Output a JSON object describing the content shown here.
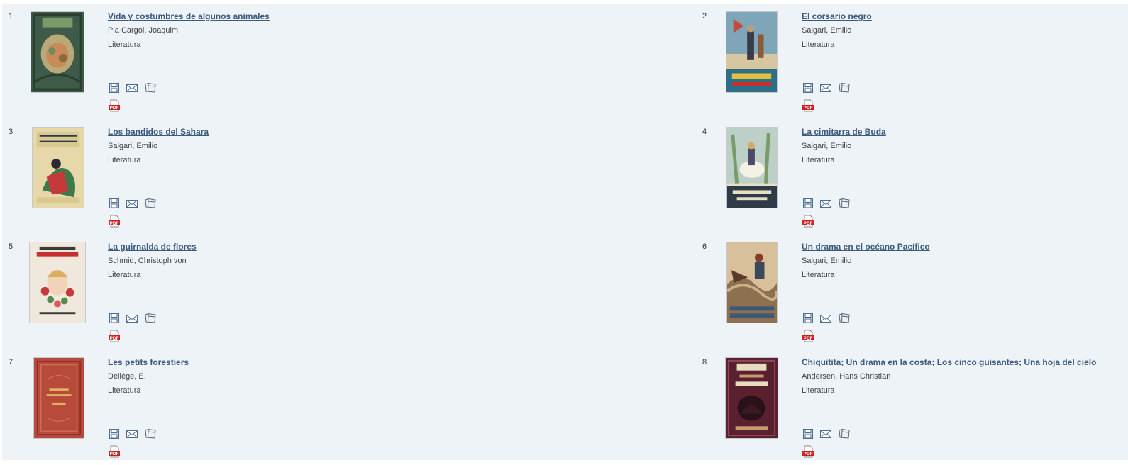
{
  "colors": {
    "panel": "#eef3f8",
    "link": "#3c5a7e",
    "text": "#444444",
    "pdf_red": "#cc1f1f"
  },
  "icons": {
    "save": "save-icon",
    "email": "email-icon",
    "bookshelf": "bookshelf-icon",
    "pdf": "pdf-icon"
  },
  "results": [
    {
      "number": "1",
      "title": "Vida y costumbres de algunos animales",
      "author": "Pla Cargol, Joaquim",
      "genre": "Literatura",
      "pdf_label": "PDF"
    },
    {
      "number": "2",
      "title": "El corsario negro",
      "author": "Salgari, Emilio",
      "genre": "Literatura",
      "pdf_label": "PDF"
    },
    {
      "number": "3",
      "title": "Los bandidos del Sahara",
      "author": "Salgari, Emilio",
      "genre": "Literatura",
      "pdf_label": "PDF"
    },
    {
      "number": "4",
      "title": "La cimitarra de Buda",
      "author": "Salgari, Emilio",
      "genre": "Literatura",
      "pdf_label": "PDF"
    },
    {
      "number": "5",
      "title": "La guirnalda de flores",
      "author": "Schmid, Christoph von",
      "genre": "Literatura",
      "pdf_label": "PDF"
    },
    {
      "number": "6",
      "title": "Un drama en el océano Pacífico",
      "author": "Salgari, Emilio",
      "genre": "Literatura",
      "pdf_label": "PDF"
    },
    {
      "number": "7",
      "title": "Les petits forestiers",
      "author": "Deliège, E.",
      "genre": "Literatura",
      "pdf_label": "PDF"
    },
    {
      "number": "8",
      "title": "Chiquitita; Un drama en la costa; Los cinco guisantes; Una hoja del cielo",
      "author": "Andersen, Hans Christian",
      "genre": "Literatura",
      "pdf_label": "PDF"
    }
  ]
}
